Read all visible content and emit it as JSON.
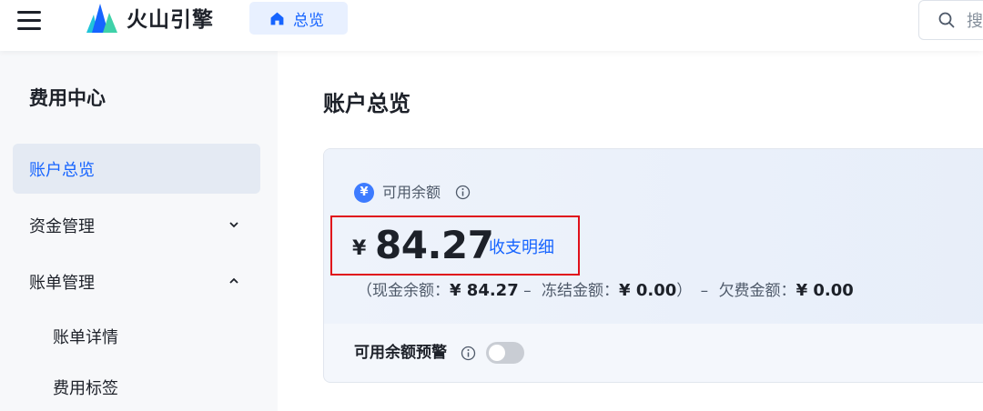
{
  "header": {
    "brand": "火山引擎",
    "tab_label": "总览",
    "search_placeholder": "搜"
  },
  "sidebar": {
    "title": "费用中心",
    "items": [
      {
        "label": "账户总览",
        "active": true
      },
      {
        "label": "资金管理",
        "expanded": false
      },
      {
        "label": "账单管理",
        "expanded": true
      }
    ],
    "subitems": [
      {
        "label": "账单详情"
      },
      {
        "label": "费用标签"
      }
    ]
  },
  "main": {
    "title": "账户总览",
    "balance_card": {
      "label": "可用余额",
      "currency_symbol": "¥",
      "amount": "84.27",
      "detail_link": "收支明细",
      "breakdown": {
        "open": "（现金余额：",
        "cash": "¥ 84.27",
        "sep1": " – ",
        "frozen_label": "冻结金额：",
        "frozen": "¥ 0.00",
        "close": "）",
        "sep2": " – ",
        "debt_label": "欠费金额：",
        "debt": "¥ 0.00"
      },
      "alert_label": "可用余额预警",
      "alert_enabled": false
    }
  },
  "colors": {
    "accent": "#1664ff",
    "highlight_border": "#e0101a"
  },
  "icons": [
    "menu-icon",
    "logo-icon",
    "home-icon",
    "search-icon",
    "yen-icon",
    "info-icon",
    "chevron-down-icon",
    "chevron-up-icon"
  ]
}
